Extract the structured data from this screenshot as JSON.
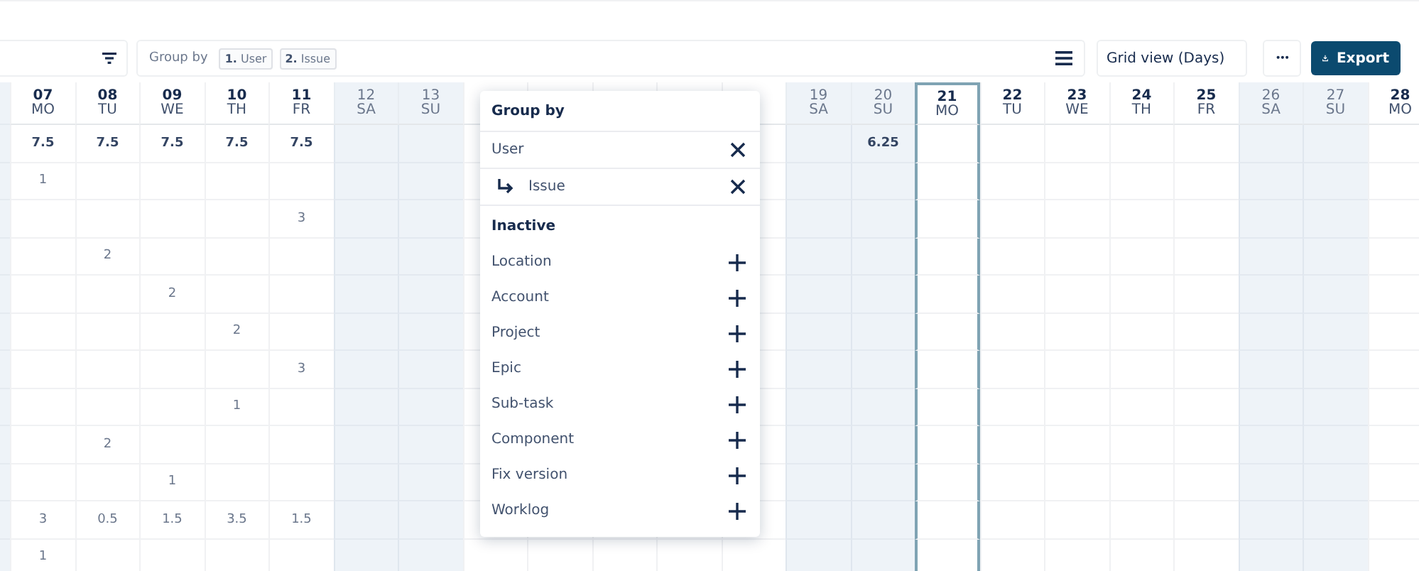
{
  "toolbar": {
    "group_by": {
      "label": "Group by",
      "chips": [
        {
          "index": "1.",
          "label": "User"
        },
        {
          "index": "2.",
          "label": "Issue"
        }
      ]
    },
    "view": "Grid view (Days)",
    "more": "•••",
    "export": "Export"
  },
  "days": [
    {
      "day": "07",
      "dow": "MO",
      "weekend": false,
      "today": false
    },
    {
      "day": "08",
      "dow": "TU",
      "weekend": false,
      "today": false
    },
    {
      "day": "09",
      "dow": "WE",
      "weekend": false,
      "today": false
    },
    {
      "day": "10",
      "dow": "TH",
      "weekend": false,
      "today": false
    },
    {
      "day": "11",
      "dow": "FR",
      "weekend": false,
      "today": false
    },
    {
      "day": "12",
      "dow": "SA",
      "weekend": true,
      "today": false
    },
    {
      "day": "13",
      "dow": "SU",
      "weekend": true,
      "today": false
    },
    {
      "weekend": false,
      "today": false
    },
    {
      "weekend": false,
      "today": false
    },
    {
      "weekend": false,
      "today": false
    },
    {
      "weekend": false,
      "today": false
    },
    {
      "weekend": false,
      "today": false
    },
    {
      "day": "19",
      "dow": "SA",
      "weekend": true,
      "today": false
    },
    {
      "day": "20",
      "dow": "SU",
      "weekend": true,
      "today": false
    },
    {
      "day": "21",
      "dow": "MO",
      "weekend": false,
      "today": true
    },
    {
      "day": "22",
      "dow": "TU",
      "weekend": false,
      "today": false
    },
    {
      "day": "23",
      "dow": "WE",
      "weekend": false,
      "today": false
    },
    {
      "day": "24",
      "dow": "TH",
      "weekend": false,
      "today": false
    },
    {
      "day": "25",
      "dow": "FR",
      "weekend": false,
      "today": false
    },
    {
      "day": "26",
      "dow": "SA",
      "weekend": true,
      "today": false
    },
    {
      "day": "27",
      "dow": "SU",
      "weekend": true,
      "today": false
    },
    {
      "day": "28",
      "dow": "MO",
      "weekend": false,
      "today": false
    }
  ],
  "rows": [
    {
      "kind": "total",
      "cells": [
        "7.5",
        "7.5",
        "7.5",
        "7.5",
        "7.5",
        null,
        null,
        null,
        null,
        null,
        null,
        null,
        null,
        "6.25",
        null,
        null,
        null,
        null,
        null,
        null,
        null,
        null
      ]
    },
    {
      "kind": "entry",
      "cells": [
        "1",
        null,
        null,
        null,
        null,
        null,
        null,
        null,
        null,
        null,
        null,
        null,
        null,
        null,
        null,
        null,
        null,
        null,
        null,
        null,
        null,
        null
      ]
    },
    {
      "kind": "entry",
      "cells": [
        null,
        null,
        null,
        null,
        "3",
        null,
        null,
        null,
        null,
        null,
        null,
        null,
        null,
        null,
        null,
        null,
        null,
        null,
        null,
        null,
        null,
        null
      ]
    },
    {
      "kind": "entry",
      "cells": [
        null,
        "2",
        null,
        null,
        null,
        null,
        null,
        null,
        null,
        null,
        null,
        null,
        null,
        null,
        null,
        null,
        null,
        null,
        null,
        null,
        null,
        null
      ]
    },
    {
      "kind": "entry",
      "cells": [
        null,
        null,
        "2",
        null,
        null,
        null,
        null,
        null,
        null,
        null,
        null,
        null,
        null,
        null,
        null,
        null,
        null,
        null,
        null,
        null,
        null,
        null
      ]
    },
    {
      "kind": "entry",
      "cells": [
        null,
        null,
        null,
        "2",
        null,
        null,
        null,
        null,
        null,
        null,
        null,
        null,
        null,
        null,
        null,
        null,
        null,
        null,
        null,
        null,
        null,
        null
      ]
    },
    {
      "kind": "entry",
      "cells": [
        null,
        null,
        null,
        null,
        "3",
        null,
        null,
        null,
        null,
        null,
        null,
        null,
        null,
        null,
        null,
        null,
        null,
        null,
        null,
        null,
        null,
        null
      ]
    },
    {
      "kind": "entry",
      "cells": [
        null,
        null,
        null,
        "1",
        null,
        null,
        null,
        null,
        null,
        null,
        null,
        null,
        null,
        null,
        null,
        null,
        null,
        null,
        null,
        null,
        null,
        null
      ]
    },
    {
      "kind": "entry",
      "cells": [
        null,
        "2",
        null,
        null,
        null,
        null,
        null,
        null,
        null,
        null,
        null,
        null,
        null,
        null,
        null,
        null,
        null,
        null,
        null,
        null,
        null,
        null
      ]
    },
    {
      "kind": "entry",
      "cells": [
        null,
        null,
        "1",
        null,
        null,
        null,
        null,
        null,
        null,
        null,
        null,
        null,
        null,
        null,
        null,
        null,
        null,
        null,
        null,
        null,
        null,
        null
      ]
    },
    {
      "kind": "entry",
      "cells": [
        "3",
        "0.5",
        "1.5",
        "3.5",
        "1.5",
        null,
        null,
        null,
        null,
        null,
        null,
        null,
        null,
        null,
        null,
        null,
        null,
        null,
        null,
        null,
        null,
        null
      ]
    },
    {
      "kind": "entry",
      "cells": [
        "1",
        null,
        null,
        null,
        null,
        null,
        null,
        null,
        null,
        null,
        null,
        null,
        null,
        null,
        null,
        null,
        null,
        null,
        null,
        null,
        null,
        null
      ]
    }
  ],
  "popup": {
    "title": "Group by",
    "active": [
      {
        "label": "User",
        "nested": false
      },
      {
        "label": "Issue",
        "nested": true
      }
    ],
    "inactive_title": "Inactive",
    "inactive": [
      "Location",
      "Account",
      "Project",
      "Epic",
      "Sub-task",
      "Component",
      "Fix version",
      "Worklog"
    ]
  }
}
